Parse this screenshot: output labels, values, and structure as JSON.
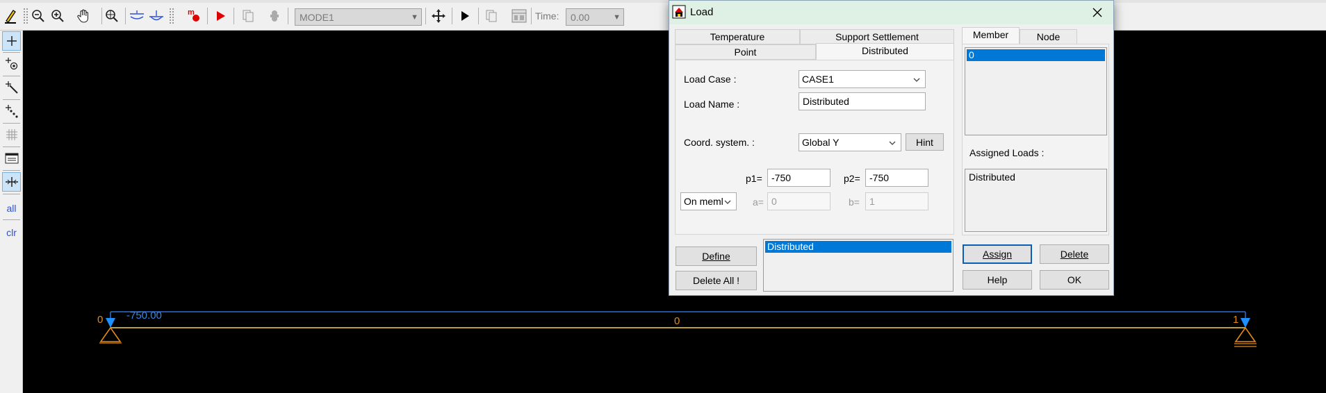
{
  "toolbar": {
    "mode_select": "MODE1",
    "time_label": "Time:",
    "time_value": "0.00"
  },
  "left_toolbar": {
    "all_label": "all",
    "clr_label": "clr"
  },
  "canvas": {
    "node_left_label": "0",
    "node_right_label": "1",
    "member_label": "0",
    "load_value_label": "-750.00"
  },
  "dialog": {
    "title": "Load",
    "tabs_row1": [
      "Temperature",
      "Support Settlement"
    ],
    "tabs_row2": [
      "Point",
      "Distributed"
    ],
    "right_tabs": [
      "Member",
      "Node"
    ],
    "load_case_label": "Load Case :",
    "load_case_value": "CASE1",
    "load_name_label": "Load Name :",
    "load_name_value": "Distributed",
    "coord_label": "Coord. system. :",
    "coord_value": "Global Y",
    "hint_button": "Hint",
    "p1_label": "p1=",
    "p1_value": "-750",
    "p2_label": "p2=",
    "p2_value": "-750",
    "on_member_value": "On meml",
    "a_label": "a=",
    "a_value": "0",
    "b_label": "b=",
    "b_value": "1",
    "define_button": "Define",
    "delete_all_button": "Delete All !",
    "loads_list": [
      "Distributed"
    ],
    "member_list": [
      "0"
    ],
    "assigned_loads_label": "Assigned Loads :",
    "assigned_loads_list": [
      "Distributed"
    ],
    "assign_button": "Assign",
    "delete_button": "Delete",
    "help_button": "Help",
    "ok_button": "OK"
  },
  "colors": {
    "load_arrow": "#1e90ff",
    "load_line": "#2f6fd6",
    "member_line": "#b8a13a",
    "support": "#e08a1e",
    "selection": "#0078d7"
  }
}
